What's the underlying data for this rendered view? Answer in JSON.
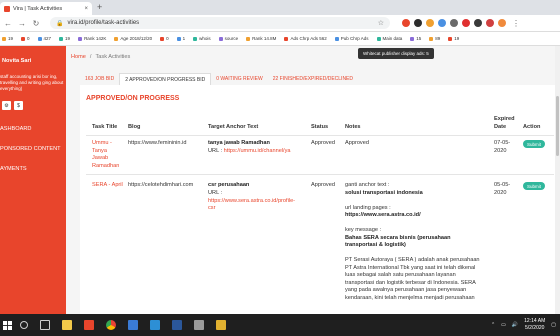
{
  "browser": {
    "tab_title": "Vira | Task Activities",
    "url": "vira.id/profile/task-activities",
    "tab_close": "×",
    "new_tab": "+",
    "lock": "🔒",
    "star": "☆",
    "menu": "⋮"
  },
  "bookmarks": [
    {
      "label": "19"
    },
    {
      "label": "0"
    },
    {
      "label": "427"
    },
    {
      "label": "19"
    },
    {
      "label": "Rank 142K"
    },
    {
      "label": "Age 2018/12/20"
    },
    {
      "label": "0"
    },
    {
      "label": "1"
    },
    {
      "label": "whois"
    },
    {
      "label": "source"
    },
    {
      "label": "Rank 14.8M"
    },
    {
      "label": "Ads Chrp Ads 562"
    },
    {
      "label": "Pub Chrp Ads"
    },
    {
      "label": "Main data"
    },
    {
      "label": "15"
    },
    {
      "label": "89"
    },
    {
      "label": "19"
    }
  ],
  "tooltip": "Whitecat publisher display ads: 5",
  "sidebar": {
    "name": "Novita Sari",
    "bio": "staff accounting arisi bor ing, travelling and writing ging about everything)",
    "btn1": "⚙",
    "btn2": "$",
    "menu": [
      {
        "label": "ASHBOARD"
      },
      {
        "label": "PONSORED CONTENT"
      },
      {
        "label": "AYMENTS"
      }
    ]
  },
  "breadcrumb": {
    "home": "Home",
    "sep": "/",
    "current": "Task Activities"
  },
  "subtabs": [
    {
      "label": "163 JOB BID",
      "active": false
    },
    {
      "label": "2 APPROVED/ON PROGRESS BID",
      "active": true
    },
    {
      "label": "0 WAITING REVIEW",
      "active": false
    },
    {
      "label": "22 FINISHED/EXPIRED/DECLINED",
      "active": false
    }
  ],
  "panel": {
    "title": "APPROVED/ON PROGRESS",
    "headers": {
      "task_title": "Task Title",
      "blog": "Blog",
      "target_anchor": "Target Anchor Text",
      "status": "Status",
      "notes": "Notes",
      "expired_date_l1": "Expired",
      "expired_date_l2": "Date",
      "action": "Action"
    },
    "rows": [
      {
        "task_title": "Ummu - Tanya Jawab Ramadhan",
        "blog": "https://www.femininin.id",
        "anchor_title": "tanya jawab Ramadhan",
        "anchor_url_label": "URL :",
        "anchor_url": "https://ummu.id/channel/ya",
        "status": "Approved",
        "notes": "Approved",
        "expired": "07-05-2020",
        "action": "Submit"
      },
      {
        "task_title": "SERA - April",
        "blog": "https://celotehdimhari.com",
        "anchor_title": "csr perusahaan",
        "anchor_url_label": "URL :",
        "anchor_url": "https://www.sera.astra.co.id/profile-csr",
        "status": "Approved",
        "notes_lines": [
          {
            "text": "ganti anchor text :",
            "bold": false
          },
          {
            "text": "solusi transportasi indonesia",
            "bold": true
          },
          {
            "text": "",
            "bold": false
          },
          {
            "text": "url landing pages :",
            "bold": false
          },
          {
            "text": "https://www.sera.astra.co.id/",
            "bold": true
          },
          {
            "text": "",
            "bold": false
          },
          {
            "text": "key message :",
            "bold": false
          },
          {
            "text": "Bahas SERA secara bisnis (perusahaan",
            "bold": true
          },
          {
            "text": "transportasi & logistik)",
            "bold": true
          },
          {
            "text": "",
            "bold": false
          },
          {
            "text": "PT Serasi Autoraya ( SERA ) adalah anak perusahaan",
            "bold": false
          },
          {
            "text": "PT Astra International Tbk yang saat ini telah dikenal",
            "bold": false
          },
          {
            "text": "luas sebagai salah satu perusahaan layanan",
            "bold": false
          },
          {
            "text": "transportasi dan logistik terbesar di Indonesia. SERA",
            "bold": false
          },
          {
            "text": "yang pada awalnya perusahaan jasa penyewaan",
            "bold": false
          },
          {
            "text": "kendaraan, kini telah menjelma menjadi perusahaan",
            "bold": false
          }
        ],
        "expired": "05-05-2020",
        "action": "Submit"
      }
    ]
  },
  "taskbar": {
    "time": "12:14 AM",
    "date": "5/2/2020"
  }
}
